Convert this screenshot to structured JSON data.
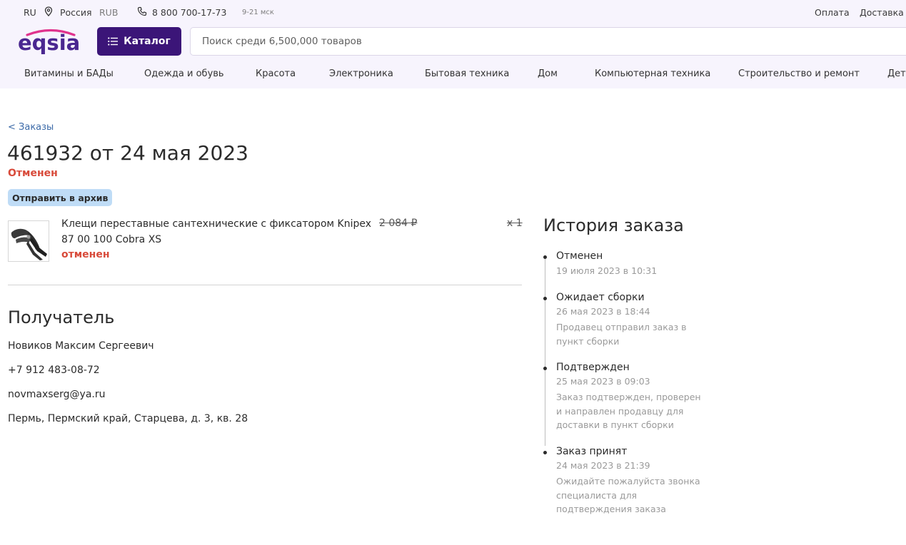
{
  "topbar": {
    "lang": "RU",
    "region": "Россия",
    "currency": "RUB",
    "phone": "8 800 700-17-73",
    "hours": "9-21 мск",
    "links": [
      "Оплата",
      "Доставка"
    ]
  },
  "header": {
    "logo_text": "eqsia",
    "catalog_label": "Каталог",
    "search_placeholder": "Поиск среди 6,500,000 товаров"
  },
  "categories": [
    "Витамины и БАДы",
    "Одежда и обувь",
    "Красота",
    "Электроника",
    "Бытовая техника",
    "Дом",
    "Компьютерная техника",
    "Строительство и ремонт",
    "Детя"
  ],
  "order": {
    "back_label": "< Заказы",
    "title": "461932 от 24 мая 2023",
    "status": "Отменен",
    "archive_label": "Отправить в архив"
  },
  "product": {
    "name": "Клещи переставные сантехнические с фиксатором Knipex 87 00 100 Cobra XS",
    "price": "2 084 ₽",
    "qty": "x 1",
    "status": "отменен"
  },
  "recipient": {
    "title": "Получатель",
    "name": "Новиков Максим Сергеевич",
    "phone": "+7 912 483-08-72",
    "email": "novmaxserg@ya.ru",
    "address": "Пермь, Пермский край, Старцева, д. 3, кв. 28"
  },
  "history": {
    "title": "История заказа",
    "entries": [
      {
        "status": "Отменен",
        "date": "19 июля 2023 в 10:31",
        "desc": ""
      },
      {
        "status": "Ожидает сборки",
        "date": "26 мая 2023 в 18:44",
        "desc": "Продавец отправил заказ в пункт сборки"
      },
      {
        "status": "Подтвержден",
        "date": "25 мая 2023 в 09:03",
        "desc": "Заказ подтвержден, проверен и направлен продавцу для доставки в пункт сборки"
      },
      {
        "status": "Заказ принят",
        "date": "24 мая 2023 в 21:39",
        "desc": "Ожидайте пожалуйста звонка специалиста для подтверждения заказа"
      }
    ]
  },
  "colors": {
    "brand": "#3b1578",
    "header_bg": "#f7f4fd",
    "link": "#3c6aa8",
    "cancelled": "#d84a3a",
    "archive_bg": "#bfdcf6"
  }
}
